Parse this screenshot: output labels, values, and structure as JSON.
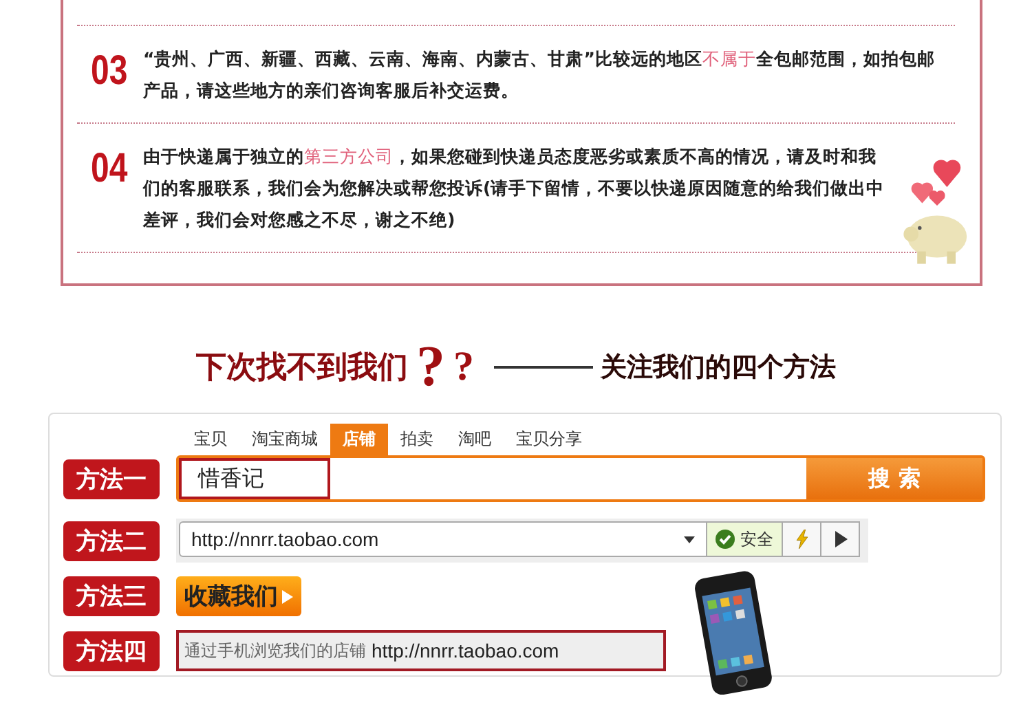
{
  "notices": [
    {
      "number": "03",
      "segments": [
        {
          "text": "“贵州、广西、新疆、西藏、云南、海南、内蒙古、甘肃”比较远的地区",
          "highlight": false
        },
        {
          "text": "不属于",
          "highlight": true
        },
        {
          "text": "全包邮范围，如拍包邮产品，请这些地方的亲们咨询客服后补交运费。",
          "highlight": false
        }
      ]
    },
    {
      "number": "04",
      "segments": [
        {
          "text": "由于快递属于独立的",
          "highlight": false
        },
        {
          "text": "第三方公司",
          "highlight": true
        },
        {
          "text": "，如果您碰到快递员态度恶劣或素质不高的情况，请及时和我们的客服联系，我们会为您解决或帮您投诉(请手下留情，不要以快递原因随意的给我们做出中差评，我们会对您感之不尽，谢之不绝)",
          "highlight": false
        }
      ]
    }
  ],
  "heading": {
    "question": "下次找不到我们",
    "marks": [
      "?",
      "?"
    ],
    "subtitle": "关注我们的四个方法"
  },
  "methods": [
    {
      "kind": "search",
      "label": "方法一",
      "tabs": [
        {
          "label": "宝贝",
          "selected": false
        },
        {
          "label": "淘宝商城",
          "selected": false
        },
        {
          "label": "店铺",
          "selected": true
        },
        {
          "label": "拍卖",
          "selected": false
        },
        {
          "label": "淘吧",
          "selected": false
        },
        {
          "label": "宝贝分享",
          "selected": false
        }
      ],
      "value": "惜香记",
      "button": "搜 索"
    },
    {
      "kind": "address",
      "label": "方法二",
      "value": "http://nnrr.taobao.com",
      "badge": "安全"
    },
    {
      "kind": "favorite",
      "label": "方法三",
      "button": "收藏我们"
    },
    {
      "kind": "mobile",
      "label": "方法四",
      "hint": "通过手机浏览我们的店铺",
      "url": "http://nnrr.taobao.com"
    }
  ]
}
